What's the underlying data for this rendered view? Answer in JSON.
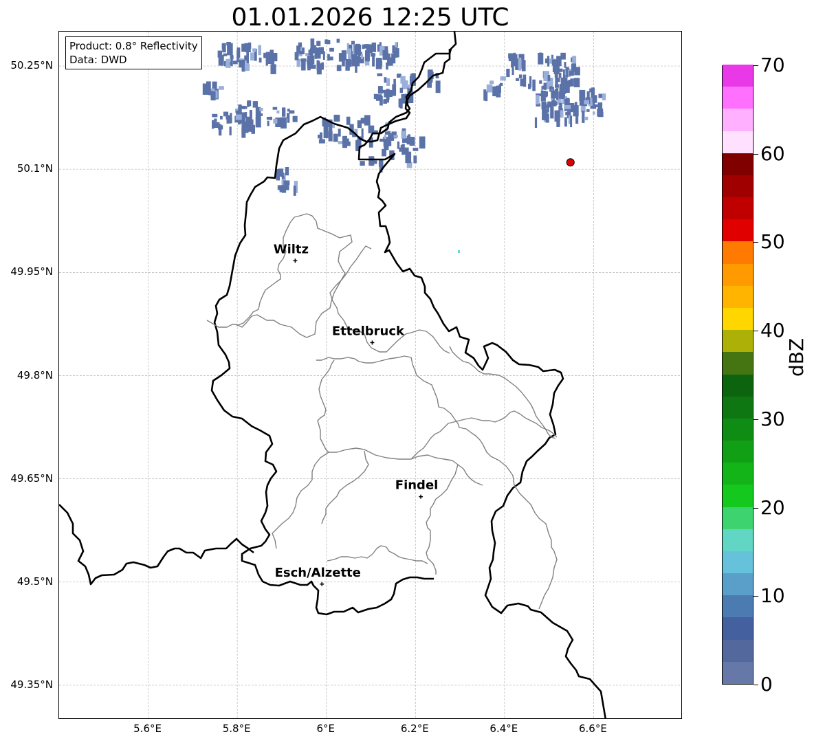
{
  "title": "01.01.2026 12:25 UTC",
  "info": {
    "product_line": "Product: 0.8° Reflectivity",
    "data_line": "Data: DWD"
  },
  "lat_ticks": [
    {
      "value": 50.25,
      "label": "50.25°N"
    },
    {
      "value": 50.1,
      "label": "50.1°N"
    },
    {
      "value": 49.95,
      "label": "49.95°N"
    },
    {
      "value": 49.8,
      "label": "49.8°N"
    },
    {
      "value": 49.65,
      "label": "49.65°N"
    },
    {
      "value": 49.5,
      "label": "49.5°N"
    },
    {
      "value": 49.35,
      "label": "49.35°N"
    }
  ],
  "lon_ticks": [
    {
      "value": 5.6,
      "label": "5.6°E"
    },
    {
      "value": 5.8,
      "label": "5.8°E"
    },
    {
      "value": 6.0,
      "label": "6°E"
    },
    {
      "value": 6.2,
      "label": "6.2°E"
    },
    {
      "value": 6.4,
      "label": "6.4°E"
    },
    {
      "value": 6.6,
      "label": "6.6°E"
    }
  ],
  "extent": {
    "lon_min": 5.4,
    "lon_max": 6.8,
    "lat_min": 49.3,
    "lat_max": 50.3
  },
  "cities": [
    {
      "name": "Wiltz",
      "lon": 5.93,
      "lat": 49.967
    },
    {
      "name": "Ettelbruck",
      "lon": 6.103,
      "lat": 49.848
    },
    {
      "name": "Findel",
      "lon": 6.212,
      "lat": 49.624
    },
    {
      "name": "Esch/Alzette",
      "lon": 5.99,
      "lat": 49.497
    }
  ],
  "radar_site": {
    "lon": 6.548,
    "lat": 50.11,
    "color": "#e00000"
  },
  "colorbar": {
    "unit": "dBZ",
    "min": 0,
    "max": 70,
    "tick_labels": [
      {
        "value": 0,
        "label": "0"
      },
      {
        "value": 10,
        "label": "10"
      },
      {
        "value": 20,
        "label": "20"
      },
      {
        "value": 30,
        "label": "30"
      },
      {
        "value": 40,
        "label": "40"
      },
      {
        "value": 50,
        "label": "50"
      },
      {
        "value": 60,
        "label": "60"
      },
      {
        "value": 70,
        "label": "70"
      }
    ],
    "colors": [
      "#6678a8",
      "#53699e",
      "#44609f",
      "#4b7bb0",
      "#5a9fca",
      "#65c2da",
      "#62d6c4",
      "#3dd470",
      "#14c81e",
      "#12b418",
      "#11a015",
      "#0f8c13",
      "#0e7711",
      "#0d640f",
      "#457513",
      "#adb007",
      "#ffd600",
      "#ffb400",
      "#ff9b00",
      "#ff7a00",
      "#e00000",
      "#c00000",
      "#a00000",
      "#800000",
      "#ffe0ff",
      "#ffb0ff",
      "#ff70ff",
      "#e838e8"
    ]
  },
  "echo_color": "#5a72a8",
  "echo_light_color": "#9ab0d8",
  "echo_cyan_color": "#5fd6d8"
}
